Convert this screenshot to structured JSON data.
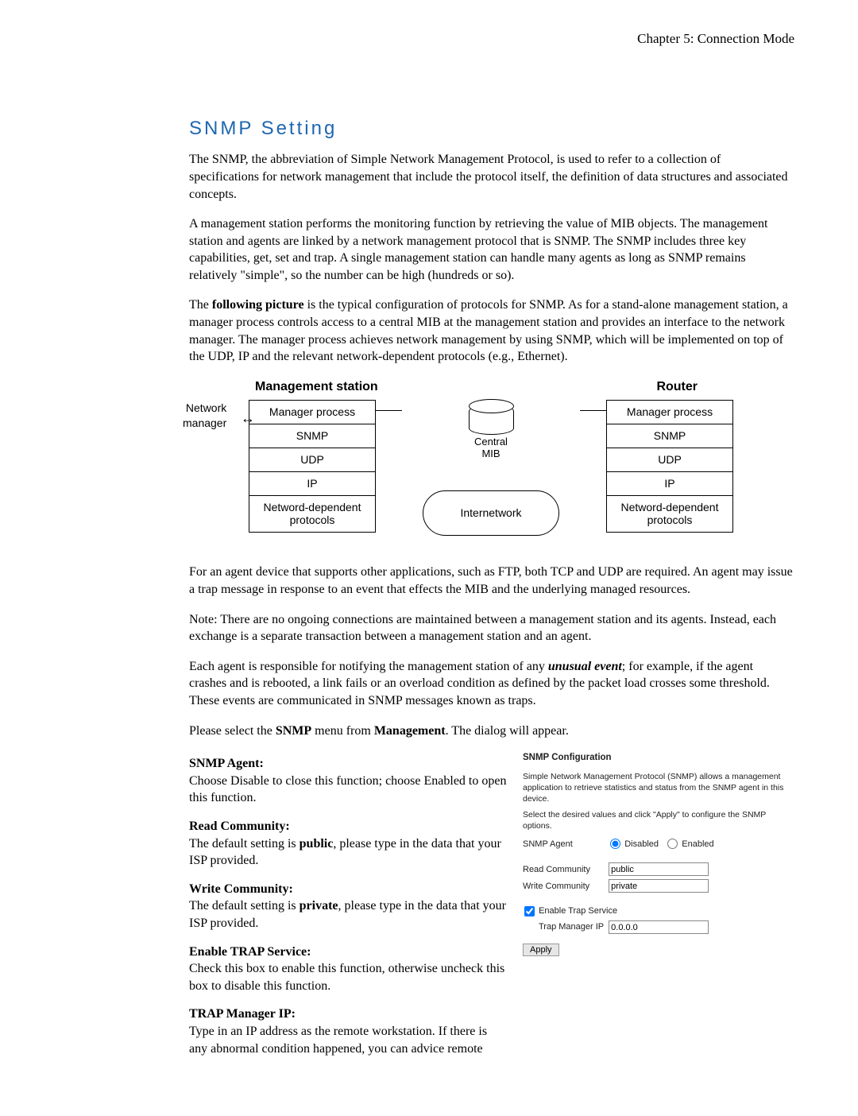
{
  "header": {
    "chapter": "Chapter 5: Connection Mode"
  },
  "section": {
    "title": "SNMP Setting"
  },
  "paragraphs": {
    "p1": "The SNMP, the abbreviation of Simple Network Management Protocol, is used to refer to a collection of specifications for network management that include the protocol itself, the definition of data structures and associated concepts.",
    "p2": "A management station performs the monitoring function by retrieving the value of MIB objects. The management station and agents are linked by a network management protocol that is SNMP. The SNMP includes three key capabilities, get, set and trap. A single management station can handle many agents as long as SNMP remains relatively \"simple\", so the number can be high (hundreds or so).",
    "p3_pre": "The ",
    "p3_bold": "following picture",
    "p3_post": " is the typical configuration of protocols for SNMP. As for a stand-alone management station, a manager process controls access to a central MIB at the management station and provides an interface to the network manager. The manager process achieves network management by using SNMP, which will be implemented on top of the UDP, IP and the relevant network-dependent protocols (e.g., Ethernet).",
    "p4": "For an agent device that supports other applications, such as FTP, both TCP and UDP are required. An agent may issue a trap message in response to an event that effects the MIB and the underlying managed resources.",
    "p5": "Note: There are no ongoing connections are maintained between a management station and its agents. Instead, each exchange is a separate transaction between a management station and an agent.",
    "p6_pre": "Each agent is responsible for notifying the management station of any ",
    "p6_bi": "unusual event",
    "p6_post": "; for example, if the agent crashes and is rebooted, a link fails or an overload condition as defined by the packet load crosses some threshold. These events are communicated in SNMP messages known as traps.",
    "p7_pre": "Please select the ",
    "p7_b1": "SNMP",
    "p7_mid": " menu from ",
    "p7_b2": "Management",
    "p7_post": ". The dialog will appear."
  },
  "diagram": {
    "header_left": "Management station",
    "header_right": "Router",
    "nm_label_l1": "Network",
    "nm_label_l2": "manager",
    "stack_left": [
      "Manager process",
      "SNMP",
      "UDP",
      "IP",
      "Netword-dependent protocols"
    ],
    "stack_right": [
      "Manager process",
      "SNMP",
      "UDP",
      "IP",
      "Netword-dependent protocols"
    ],
    "db_l1": "Central",
    "db_l2": "MIB",
    "cloud": "Internetwork"
  },
  "fields": {
    "agent": {
      "title": "SNMP Agent:",
      "body": "Choose Disable to close this function; choose Enabled to open this function."
    },
    "read": {
      "title": "Read Community:",
      "body_pre": "The default setting is ",
      "body_b": "public",
      "body_post": ", please type in the data that your ISP provided."
    },
    "write": {
      "title": "Write Community:",
      "body_pre": "The default setting is ",
      "body_b": "private",
      "body_post": ", please type in the data that your ISP provided."
    },
    "trap": {
      "title": "Enable TRAP Service:",
      "body": "Check this box to enable this function, otherwise uncheck this box to disable this function."
    },
    "tip": {
      "title": "TRAP Manager IP:",
      "body": "Type in an IP address as the remote workstation. If there is any abnormal condition happened, you can advice remote"
    }
  },
  "panel": {
    "title": "SNMP Configuration",
    "desc1": "Simple Network Management Protocol (SNMP) allows a management application to retrieve statistics and status from the SNMP agent in this device.",
    "desc2": "Select the desired values and click \"Apply\" to configure the SNMP options.",
    "row_agent": "SNMP Agent",
    "opt_disabled": "Disabled",
    "opt_enabled": "Enabled",
    "row_read": "Read Community",
    "val_read": "public",
    "row_write": "Write Community",
    "val_write": "private",
    "row_trapchk": "Enable Trap Service",
    "row_trapip": "Trap Manager IP",
    "val_trapip": "0.0.0.0",
    "btn_apply": "Apply"
  }
}
